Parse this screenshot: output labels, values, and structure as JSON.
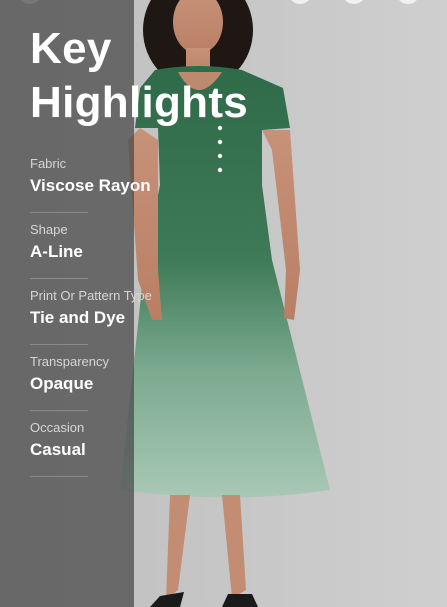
{
  "title": "Key\nHighlights",
  "specs": [
    {
      "label": "Fabric",
      "value": "Viscose Rayon"
    },
    {
      "label": "Shape",
      "value": "A-Line"
    },
    {
      "label": "Print Or Pattern Type",
      "value": "Tie and Dye"
    },
    {
      "label": "Transparency",
      "value": "Opaque"
    },
    {
      "label": "Occasion",
      "value": "Casual"
    }
  ],
  "colors": {
    "overlay": "#464646",
    "dress_dark": "#2f6a49",
    "dress_light": "#9fc2ad",
    "text": "#ffffff"
  }
}
